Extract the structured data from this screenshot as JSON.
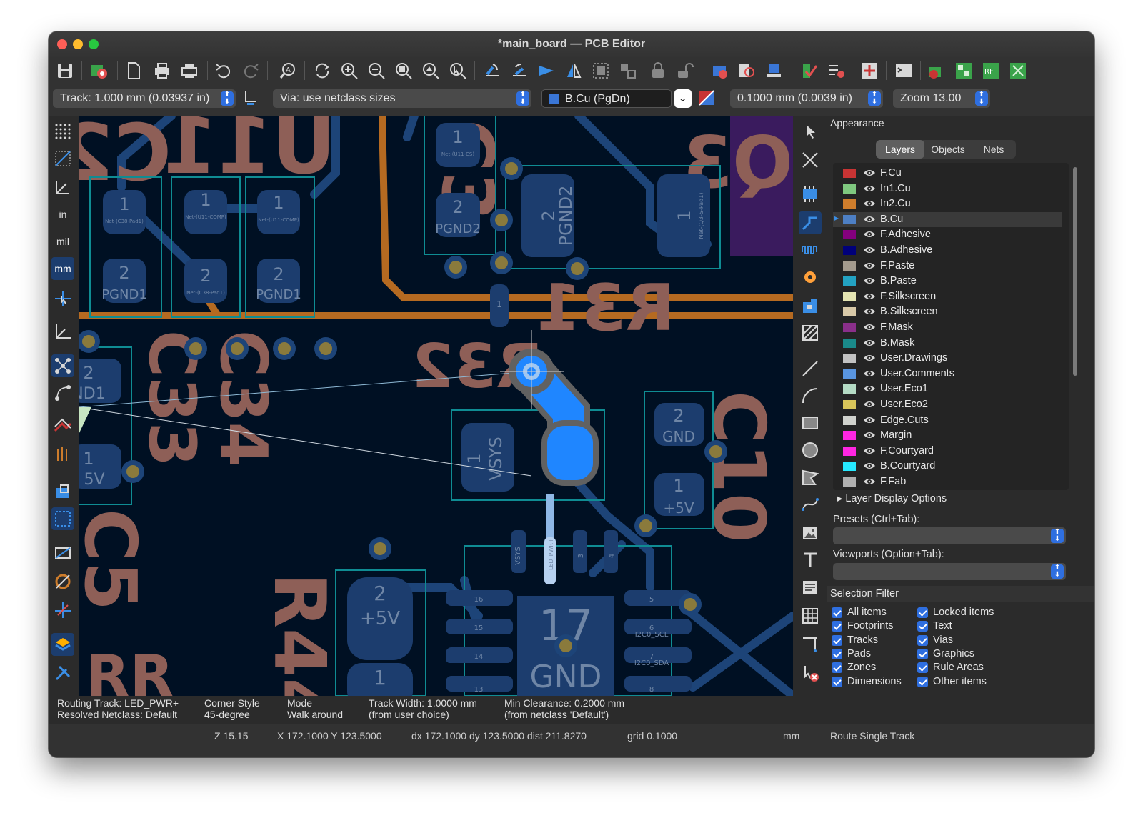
{
  "window": {
    "title": "*main_board — PCB Editor"
  },
  "toolbar": {
    "icons": [
      "save-icon",
      "board-setup-icon",
      "page-settings-icon",
      "print-icon",
      "plot-icon",
      "undo-icon",
      "redo-icon",
      "find-icon",
      "redraw-icon",
      "zoom-in-icon",
      "zoom-out-icon",
      "zoom-fit-icon",
      "zoom-objects-icon",
      "zoom-selection-icon",
      "rotate-ccw-icon",
      "rotate-cw-icon",
      "flip-icon",
      "mirror-icon",
      "group-icon",
      "ungroup-icon",
      "lock-icon",
      "unlock-icon",
      "footprint-editor-icon",
      "footprint-browser-icon",
      "update-from-schematic-icon",
      "drc-icon",
      "net-inspector-icon",
      "net-highlight-icon",
      "scripting-console-icon",
      "freerouter-icon",
      "board-stats-icon",
      "rf-tools-icon",
      "route-icon"
    ]
  },
  "options": {
    "track": "Track: 1.000 mm (0.03937 in)",
    "via": "Via: use netclass sizes",
    "layer": "B.Cu (PgDn)",
    "grid": "0.1000 mm (0.0039 in)",
    "zoom": "Zoom 13.00",
    "colors": {
      "layer_swatch": "#3a76d6"
    }
  },
  "left_tools": [
    "grid-toggle-icon",
    "grid-overrides-icon",
    "polar-coords-icon",
    "inches-icon",
    "mils-icon",
    "millimeters-icon",
    "cursor-full-icon",
    "measure-icon",
    "ratsnest-icon",
    "curved-ratsnest-icon",
    "zones-filled-icon",
    "tracks-outline-icon",
    "pads-outline-icon",
    "vias-outline-icon",
    "graphics-outline-icon",
    "net-colors-icon",
    "drc-markers-icon",
    "layers-manager-icon",
    "properties-icon"
  ],
  "left_tool_labels": {
    "in": "in",
    "mil": "mil",
    "mm": "mm"
  },
  "right_tools": [
    "select-arrow-icon",
    "local-ratsnest-icon",
    "add-footprint-icon",
    "route-track-icon",
    "tune-length-icon",
    "add-via-icon",
    "add-zone-icon",
    "rule-area-icon",
    "draw-line-icon",
    "draw-arc-icon",
    "draw-rectangle-icon",
    "draw-circle-icon",
    "draw-polygon-icon",
    "add-bezier-icon",
    "add-image-icon",
    "add-text-icon",
    "add-textbox-icon",
    "add-table-icon",
    "add-dimension-icon",
    "delete-tool-icon"
  ],
  "appearance": {
    "title": "Appearance",
    "tabs": [
      "Layers",
      "Objects",
      "Nets"
    ],
    "active_tab": "Layers",
    "layers": [
      {
        "name": "F.Cu",
        "color": "#c83434"
      },
      {
        "name": "In1.Cu",
        "color": "#7fc87f"
      },
      {
        "name": "In2.Cu",
        "color": "#ce7d2c"
      },
      {
        "name": "B.Cu",
        "color": "#4d7fc4",
        "selected": true
      },
      {
        "name": "F.Adhesive",
        "color": "#84007d"
      },
      {
        "name": "B.Adhesive",
        "color": "#00007a"
      },
      {
        "name": "F.Paste",
        "color": "#a49b8e"
      },
      {
        "name": "B.Paste",
        "color": "#23a2c2"
      },
      {
        "name": "F.Silkscreen",
        "color": "#e4e4b2"
      },
      {
        "name": "B.Silkscreen",
        "color": "#d8c9a8"
      },
      {
        "name": "F.Mask",
        "color": "#8a2f8a"
      },
      {
        "name": "B.Mask",
        "color": "#1a8a8a"
      },
      {
        "name": "User.Drawings",
        "color": "#c2c2c2"
      },
      {
        "name": "User.Comments",
        "color": "#5995e0"
      },
      {
        "name": "User.Eco1",
        "color": "#b4dbc4"
      },
      {
        "name": "User.Eco2",
        "color": "#d8c55a"
      },
      {
        "name": "Edge.Cuts",
        "color": "#d0d2cd"
      },
      {
        "name": "Margin",
        "color": "#ff26e2"
      },
      {
        "name": "F.Courtyard",
        "color": "#ff26e2"
      },
      {
        "name": "B.Courtyard",
        "color": "#26e9ff"
      },
      {
        "name": "F.Fab",
        "color": "#afafaf"
      }
    ],
    "layer_display_options": "Layer Display Options",
    "presets_label": "Presets (Ctrl+Tab):",
    "viewports_label": "Viewports (Option+Tab):"
  },
  "selection_filter": {
    "title": "Selection Filter",
    "left": [
      "All items",
      "Footprints",
      "Tracks",
      "Pads",
      "Zones",
      "Dimensions"
    ],
    "right": [
      "Locked items",
      "Text",
      "Vias",
      "Graphics",
      "Rule Areas",
      "Other items"
    ]
  },
  "messages": {
    "routing": "Routing Track: LED_PWR+",
    "netclass": "Resolved Netclass: Default",
    "corner_label": "Corner Style",
    "corner_value": "45-degree",
    "mode_label": "Mode",
    "mode_value": "Walk around",
    "track_width": "Track Width: 1.0000 mm",
    "track_width_src": "(from user choice)",
    "clearance": "Min Clearance: 0.2000 mm",
    "clearance_src": "(from netclass 'Default')"
  },
  "status": {
    "z": "Z 15.15",
    "xy": "X 172.1000  Y 123.5000",
    "dxy": "dx 172.1000  dy 123.5000  dist 211.8270",
    "grid": "grid 0.1000",
    "units": "mm",
    "tool": "Route Single Track"
  },
  "board": {
    "silk": {
      "c2x": "C2",
      "u11": "U11",
      "c3": "C3",
      "r31": "R31",
      "q3": "Q3",
      "c33": "C33",
      "c34": "C34",
      "r32": "R32",
      "c10": "C10",
      "r44": "R44",
      "c5": "C5",
      "pp": "RR"
    },
    "pads": {
      "one": "1",
      "two": "2",
      "pgnd1": "PGND1",
      "pgnd2": "PGND2",
      "vsys": "VSYS",
      "gnd": "GND",
      "plus5v": "+5V",
      "five_v": "5V",
      "nd1": "ND1",
      "pin17": "17",
      "pin16": "16",
      "pin15": "15",
      "pin14": "14",
      "pin13": "13",
      "pin5": "5",
      "pin6": "6",
      "pin7": "7",
      "pin8": "8",
      "pin3": "3",
      "pin4": "4",
      "i2c_scl": "I2C0_SCL",
      "i2c_sda": "I2C0_SDA",
      "led_pwr": "LED_PWR+",
      "net_c38": "Net-(C38-Pad1)",
      "net_u11comp": "Net-(U11-COMP)",
      "net_u11cs": "Net-(U11-CS)",
      "net_q3": "Net-(Q3-S-Pad1)"
    }
  }
}
